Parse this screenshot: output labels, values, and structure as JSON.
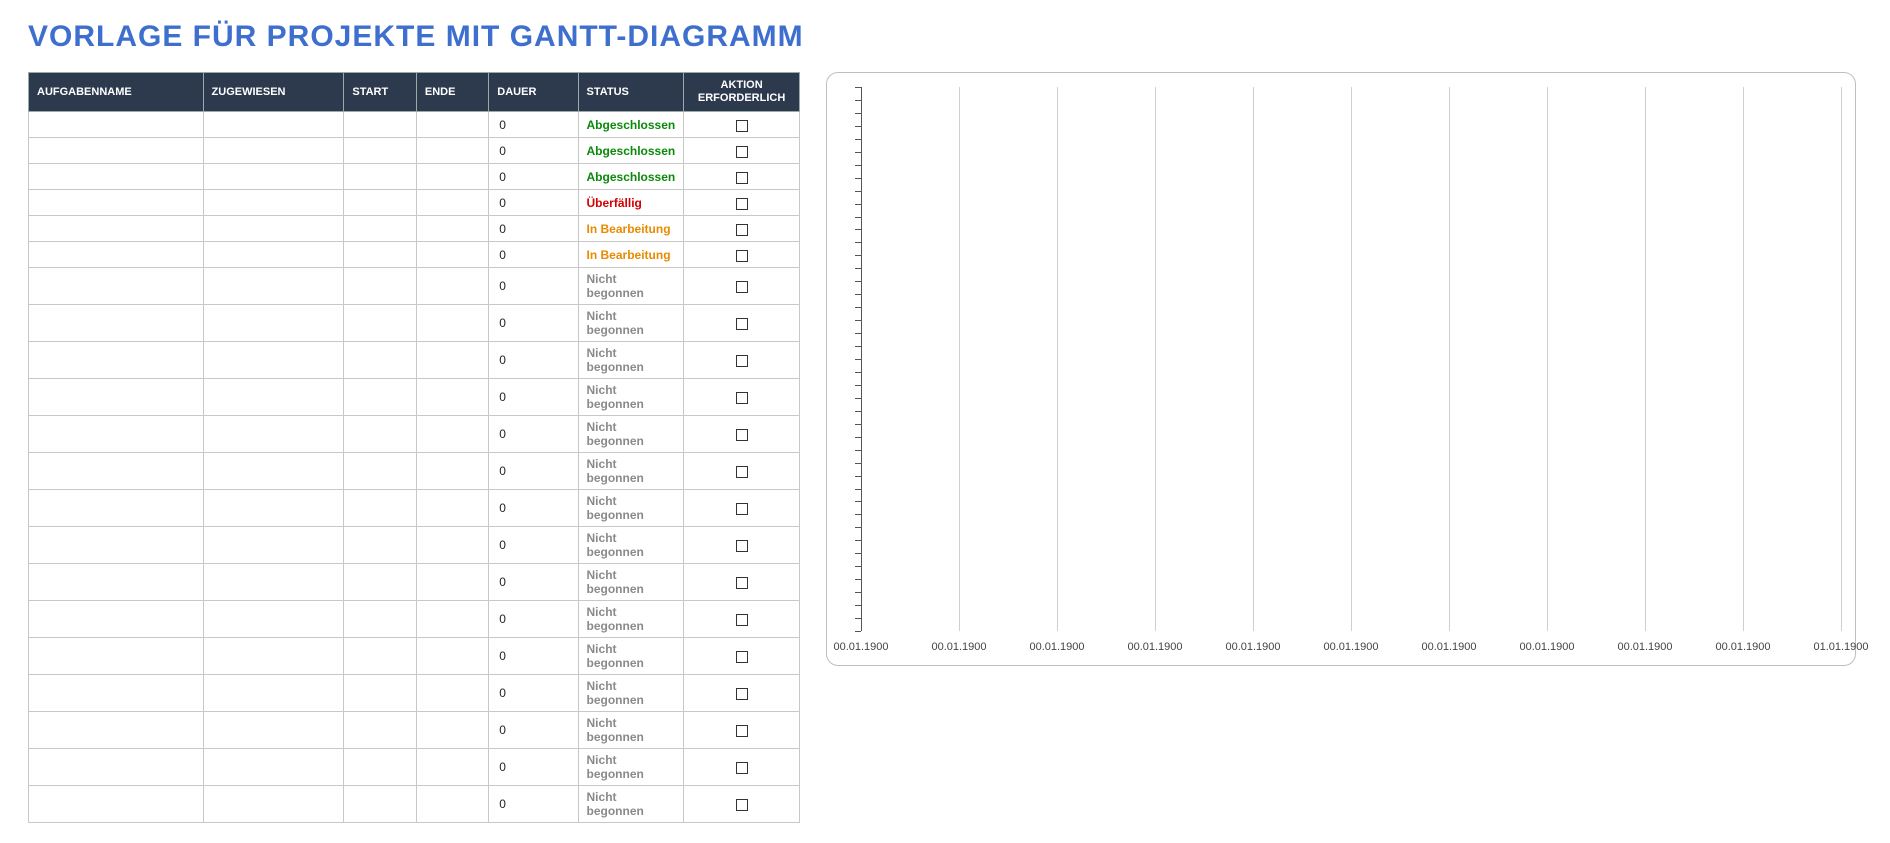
{
  "title": "VORLAGE FÜR PROJEKTE MIT GANTT-DIAGRAMM",
  "columns": {
    "name": "AUFGABENNAME",
    "assignee": "ZUGEWIESEN",
    "start": "START",
    "end": "ENDE",
    "duration": "DAUER",
    "status": "STATUS",
    "action": "AKTION ERFORDERLICH"
  },
  "status_labels": {
    "done": "Abgeschlossen",
    "overdue": "Überfällig",
    "in_progress": "In Bearbeitung",
    "not_started": "Nicht begonnen"
  },
  "rows": [
    {
      "name": "",
      "assignee": "",
      "start": "",
      "end": "",
      "duration": "0",
      "status": "done",
      "action_required": false
    },
    {
      "name": "",
      "assignee": "",
      "start": "",
      "end": "",
      "duration": "0",
      "status": "done",
      "action_required": false
    },
    {
      "name": "",
      "assignee": "",
      "start": "",
      "end": "",
      "duration": "0",
      "status": "done",
      "action_required": false
    },
    {
      "name": "",
      "assignee": "",
      "start": "",
      "end": "",
      "duration": "0",
      "status": "overdue",
      "action_required": false
    },
    {
      "name": "",
      "assignee": "",
      "start": "",
      "end": "",
      "duration": "0",
      "status": "in_progress",
      "action_required": false
    },
    {
      "name": "",
      "assignee": "",
      "start": "",
      "end": "",
      "duration": "0",
      "status": "in_progress",
      "action_required": false
    },
    {
      "name": "",
      "assignee": "",
      "start": "",
      "end": "",
      "duration": "0",
      "status": "not_started",
      "action_required": false
    },
    {
      "name": "",
      "assignee": "",
      "start": "",
      "end": "",
      "duration": "0",
      "status": "not_started",
      "action_required": false
    },
    {
      "name": "",
      "assignee": "",
      "start": "",
      "end": "",
      "duration": "0",
      "status": "not_started",
      "action_required": false
    },
    {
      "name": "",
      "assignee": "",
      "start": "",
      "end": "",
      "duration": "0",
      "status": "not_started",
      "action_required": false
    },
    {
      "name": "",
      "assignee": "",
      "start": "",
      "end": "",
      "duration": "0",
      "status": "not_started",
      "action_required": false
    },
    {
      "name": "",
      "assignee": "",
      "start": "",
      "end": "",
      "duration": "0",
      "status": "not_started",
      "action_required": false
    },
    {
      "name": "",
      "assignee": "",
      "start": "",
      "end": "",
      "duration": "0",
      "status": "not_started",
      "action_required": false
    },
    {
      "name": "",
      "assignee": "",
      "start": "",
      "end": "",
      "duration": "0",
      "status": "not_started",
      "action_required": false
    },
    {
      "name": "",
      "assignee": "",
      "start": "",
      "end": "",
      "duration": "0",
      "status": "not_started",
      "action_required": false
    },
    {
      "name": "",
      "assignee": "",
      "start": "",
      "end": "",
      "duration": "0",
      "status": "not_started",
      "action_required": false
    },
    {
      "name": "",
      "assignee": "",
      "start": "",
      "end": "",
      "duration": "0",
      "status": "not_started",
      "action_required": false
    },
    {
      "name": "",
      "assignee": "",
      "start": "",
      "end": "",
      "duration": "0",
      "status": "not_started",
      "action_required": false
    },
    {
      "name": "",
      "assignee": "",
      "start": "",
      "end": "",
      "duration": "0",
      "status": "not_started",
      "action_required": false
    },
    {
      "name": "",
      "assignee": "",
      "start": "",
      "end": "",
      "duration": "0",
      "status": "not_started",
      "action_required": false
    },
    {
      "name": "",
      "assignee": "",
      "start": "",
      "end": "",
      "duration": "0",
      "status": "not_started",
      "action_required": false
    }
  ],
  "chart_data": {
    "type": "bar",
    "categories": [
      "00.01.1900",
      "00.01.1900",
      "00.01.1900",
      "00.01.1900",
      "00.01.1900",
      "00.01.1900",
      "00.01.1900",
      "00.01.1900",
      "00.01.1900",
      "00.01.1900",
      "01.01.1900"
    ],
    "series": [],
    "title": "",
    "xlabel": "",
    "ylabel": "",
    "y_tick_count": 43
  }
}
